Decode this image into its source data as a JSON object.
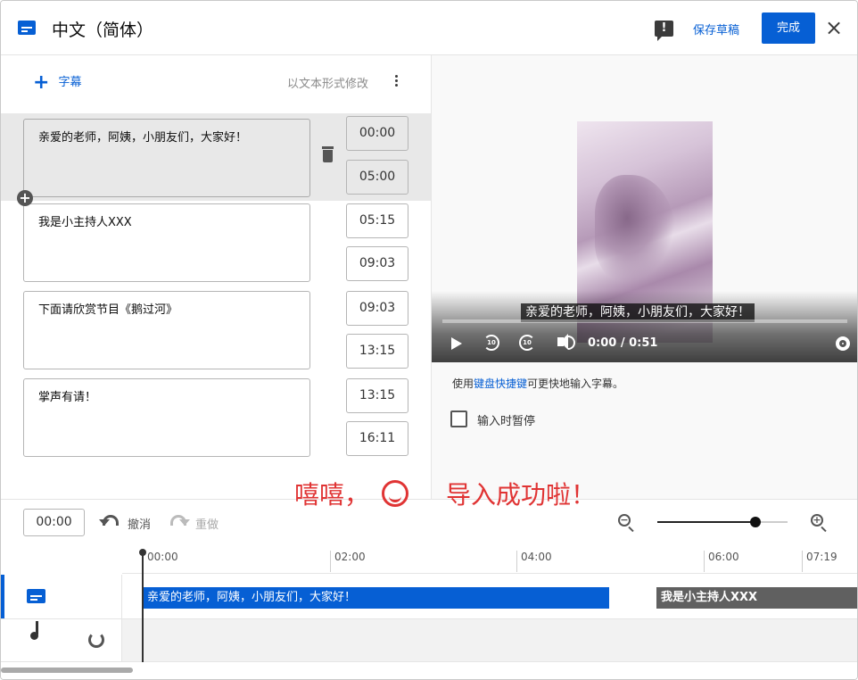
{
  "header": {
    "title": "中文（简体）",
    "save_draft": "保存草稿",
    "done": "完成",
    "close": "×",
    "feedback": "!"
  },
  "left_panel": {
    "add_subtitle": "字幕",
    "edit_as_text": "以文本形式修改",
    "cues": [
      {
        "text": "亲爱的老师，阿姨，小朋友们，大家好！",
        "start": "00:00",
        "end": "05:00"
      },
      {
        "text": "我是小主持人XXX",
        "start": "05:15",
        "end": "09:03"
      },
      {
        "text": "下面请欣赏节目《鹅过河》",
        "start": "09:03",
        "end": "13:15"
      },
      {
        "text": "掌声有请！",
        "start": "13:15",
        "end": "16:11"
      }
    ]
  },
  "player": {
    "caption": "亲爱的老师，阿姨，小朋友们，大家好！",
    "time": "0:00 / 0:51",
    "rewind_label": "10",
    "forward_label": "10",
    "progress": 0
  },
  "hints": {
    "shortcut_prefix": "使用",
    "shortcut_link": "键盘快捷键",
    "shortcut_suffix": "可更快地输入字幕。",
    "pause_while_typing": "输入时暂停"
  },
  "annotation": {
    "left": "嘻嘻，",
    "right": "导入成功啦！"
  },
  "timeline": {
    "current_time": "00:00",
    "undo": "撤消",
    "redo": "重做",
    "zoom_level": 0.75,
    "ticks": [
      "00:00",
      "02:00",
      "04:00",
      "06:00",
      "07:19"
    ],
    "clips": [
      "亲爱的老师，阿姨，小朋友们，大家好！",
      "我是小主持人XXX"
    ]
  },
  "colors": {
    "accent": "#065fd4",
    "annotation": "#e03434"
  }
}
